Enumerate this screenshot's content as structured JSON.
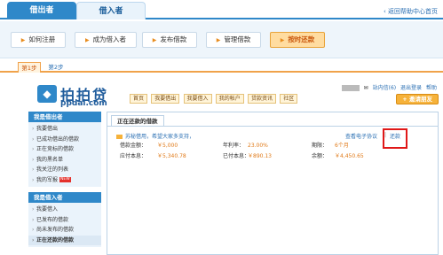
{
  "top_tabs": {
    "lender": "借出者",
    "borrower": "借入者"
  },
  "help_link": "返回帮助中心首页",
  "steps": [
    {
      "label": "如何注册",
      "active": false
    },
    {
      "label": "成为借入者",
      "active": false
    },
    {
      "label": "发布借款",
      "active": false
    },
    {
      "label": "管理借款",
      "active": false
    },
    {
      "label": "按时还款",
      "active": true
    }
  ],
  "sub_tabs": {
    "step1": "第1步",
    "step2": "第2步"
  },
  "logo": {
    "cn": "拍拍贷",
    "en": "ppdai.com"
  },
  "nav": [
    "首页",
    "我要借出",
    "我要借入",
    "我的帐户",
    "贷款资讯",
    "社区"
  ],
  "userbar": {
    "inbox": "站内信(6)",
    "logout": "退出登录",
    "help": "帮助"
  },
  "invite_button": "邀请朋友",
  "sidebar": {
    "lender_head": "我是借出者",
    "lender_items": [
      "我要借出",
      "已成功借出的借款",
      "正在竞标的借款",
      "我的黑名单",
      "我关注的列表",
      "我的军报"
    ],
    "lender_new_tag": "NEW",
    "borrower_head": "我是借入者",
    "borrower_items": [
      "我要借入",
      "已发布的借款",
      "尚未发布的借款",
      "正在还款的借款"
    ]
  },
  "main": {
    "tab_title": "正在还款的借款",
    "loan_title": "苏秘借用，希望大家多支持，",
    "contract_link": "查看电子协议",
    "separator": "|",
    "repay_link": "还款",
    "fields": {
      "loan_amount_label": "借款金额：",
      "loan_amount": "￥5,000",
      "due_principal_label": "应付本息：",
      "due_principal": "￥5,340.78",
      "rate_label": "年利率：",
      "rate": "23.00%",
      "paid_label": "已付本息：",
      "paid": "￥890.13",
      "term_label": "期限：",
      "term": "6个月",
      "balance_label": "余额：",
      "balance": "￥4,450.65"
    }
  }
}
